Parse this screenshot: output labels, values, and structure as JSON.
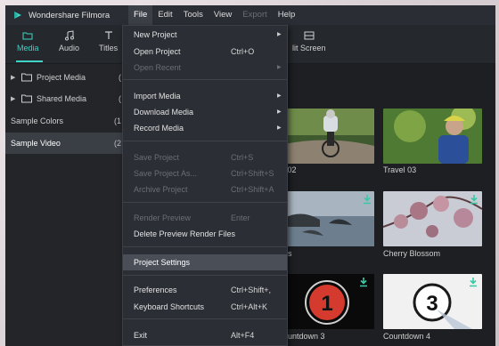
{
  "app": {
    "name": "Wondershare Filmora",
    "menu": [
      "File",
      "Edit",
      "Tools",
      "View",
      "Export",
      "Help"
    ]
  },
  "toolbar": {
    "media": "Media",
    "audio": "Audio",
    "titles": "Titles",
    "split_screen": "lit Screen"
  },
  "sidebar": {
    "items": [
      {
        "label": "Project Media",
        "count": "("
      },
      {
        "label": "Shared Media",
        "count": "("
      },
      {
        "label": "Sample Colors",
        "count": "(1"
      },
      {
        "label": "Sample Video",
        "count": "(2"
      }
    ]
  },
  "media": {
    "tiles": [
      {
        "caption": "l 02",
        "icon": "cyclist-thumbnail"
      },
      {
        "caption": "Travel 03",
        "icon": "biker-helmet-thumbnail"
      },
      {
        "caption": "ds",
        "icon": "islands-thumbnail"
      },
      {
        "caption": "Cherry Blossom",
        "icon": "cherry-blossom-thumbnail"
      },
      {
        "caption": "ountdown 3",
        "icon": "countdown-1-thumbnail"
      },
      {
        "caption": "Countdown 4",
        "icon": "countdown-3-thumbnail"
      }
    ]
  },
  "file_menu": {
    "new_project": "New Project",
    "open_project": "Open Project",
    "open_project_sc": "Ctrl+O",
    "open_recent": "Open Recent",
    "import_media": "Import Media",
    "download_media": "Download Media",
    "record_media": "Record Media",
    "save_project": "Save Project",
    "save_project_sc": "Ctrl+S",
    "save_project_as": "Save Project As...",
    "save_project_as_sc": "Ctrl+Shift+S",
    "archive_project": "Archive Project",
    "archive_project_sc": "Ctrl+Shift+A",
    "render_preview": "Render Preview",
    "render_preview_sc": "Enter",
    "delete_preview": "Delete Preview Render Files",
    "project_settings": "Project Settings",
    "preferences": "Preferences",
    "preferences_sc": "Ctrl+Shift+,",
    "keyboard_shortcuts": "Keyboard Shortcuts",
    "keyboard_shortcuts_sc": "Ctrl+Alt+K",
    "exit": "Exit",
    "exit_sc": "Alt+F4",
    "submenu_arrow": "▶"
  },
  "colors": {
    "accent": "#3ed3c4",
    "download_arrow": "#39c9a6"
  }
}
